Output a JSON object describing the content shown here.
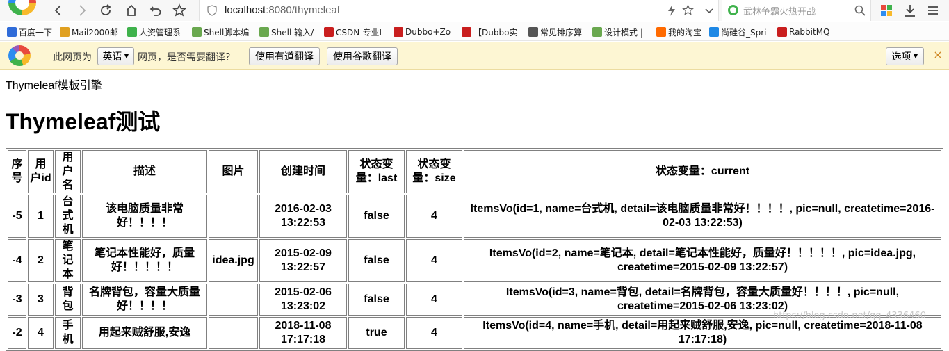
{
  "browser": {
    "url_host": "localhost",
    "url_port_path": ":8080/thymeleaf",
    "search_placeholder": "武林争霸火热开战"
  },
  "bookmarks": [
    {
      "label": "百度一下",
      "color": "#2f6bd8"
    },
    {
      "label": "Mail2000邮",
      "color": "#e0a020"
    },
    {
      "label": "人资管理系",
      "color": "#3fb24c"
    },
    {
      "label": "Shell脚本编",
      "color": "#6aa84f"
    },
    {
      "label": "Shell 输入/",
      "color": "#6aa84f"
    },
    {
      "label": "CSDN-专业I",
      "color": "#c91e1e"
    },
    {
      "label": "Dubbo+Zo",
      "color": "#c91e1e"
    },
    {
      "label": "【Dubbo实",
      "color": "#c91e1e"
    },
    {
      "label": "常见排序算",
      "color": "#555555"
    },
    {
      "label": "设计模式 |",
      "color": "#6aa84f"
    },
    {
      "label": "我的淘宝",
      "color": "#ff6a00"
    },
    {
      "label": "尚硅谷_Spri",
      "color": "#1e88e5"
    },
    {
      "label": "RabbitMQ",
      "color": "#c91e1e"
    }
  ],
  "translate_bar": {
    "prefix": "此网页为",
    "language": "英语",
    "suffix": "网页，是否需要翻译？",
    "youdao_button": "使用有道翻译",
    "google_button": "使用谷歌翻译",
    "options_button": "选项",
    "close": "×"
  },
  "page": {
    "subtitle": "Thymeleaf模板引擎",
    "heading": "Thymeleaf测试"
  },
  "table": {
    "headers": [
      "序号",
      "用户id",
      "用户名",
      "描述",
      "图片",
      "创建时间",
      "状态变量：last",
      "状态变量：size",
      "状态变量：current"
    ],
    "rows": [
      [
        "-5",
        "1",
        "台式机",
        "该电脑质量非常好！！！！",
        "",
        "2016-02-03 13:22:53",
        "false",
        "4",
        "ItemsVo(id=1, name=台式机, detail=该电脑质量非常好！！！！, pic=null, createtime=2016-02-03 13:22:53)"
      ],
      [
        "-4",
        "2",
        "笔记本",
        "笔记本性能好，质量好！！！！！",
        "idea.jpg",
        "2015-02-09 13:22:57",
        "false",
        "4",
        "ItemsVo(id=2, name=笔记本, detail=笔记本性能好，质量好！！！！！, pic=idea.jpg, createtime=2015-02-09 13:22:57)"
      ],
      [
        "-3",
        "3",
        "背包",
        "名牌背包，容量大质量好！！！！",
        "",
        "2015-02-06 13:23:02",
        "false",
        "4",
        "ItemsVo(id=3, name=背包, detail=名牌背包，容量大质量好！！！！, pic=null, createtime=2015-02-06 13:23:02)"
      ],
      [
        "-2",
        "4",
        "手机",
        "用起来贼舒服,安逸",
        "",
        "2018-11-08 17:17:18",
        "true",
        "4",
        "ItemsVo(id=4, name=手机, detail=用起来贼舒服,安逸, pic=null, createtime=2018-11-08 17:17:18)"
      ]
    ]
  },
  "watermark": "https://blog.csdn.net/qq_4336460"
}
